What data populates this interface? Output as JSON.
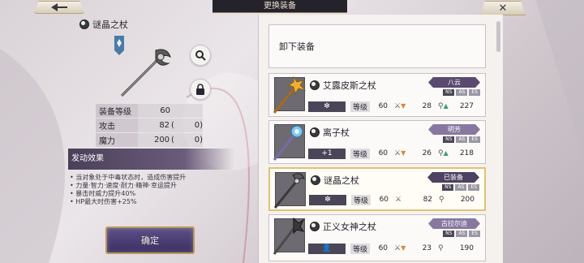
{
  "header": {
    "title": "更换装备"
  },
  "detail": {
    "item_name": "谜晶之杖",
    "stats": [
      {
        "label": "装备等级",
        "value": "60",
        "paren_open": "",
        "bonus": ""
      },
      {
        "label": "攻击",
        "value": "82",
        "paren_open": "(",
        "bonus": "0)"
      },
      {
        "label": "魔力",
        "value": "200",
        "paren_open": "(",
        "bonus": "0)"
      }
    ],
    "effect_title": "发动效果",
    "effects": [
      "• 当对象处于中毒状态时，造成伤害提升",
      "• 力量·智力·速度·耐力·精神·幸运提升",
      "• 暴击时威力提升40%",
      "• HP最大时伤害+25%"
    ],
    "confirm_label": "确定"
  },
  "list": {
    "unequip_label": "卸下装备",
    "level_label": "等级",
    "ns": "NS",
    "as": "AS",
    "es": "ES",
    "items": [
      {
        "name": "艾露皮斯之杖",
        "owner": "八云",
        "slot": "✼",
        "level": "60",
        "atk": "28",
        "atk_trend": "▼",
        "mag": "227",
        "mag_trend": "▲"
      },
      {
        "name": "离子杖",
        "owner": "明芳",
        "slot": "+1",
        "level": "60",
        "atk": "26",
        "atk_trend": "▼",
        "mag": "218",
        "mag_trend": "▲"
      },
      {
        "name": "谜晶之杖",
        "owner": "已装备",
        "slot": "✼",
        "level": "60",
        "atk": "82",
        "atk_trend": "",
        "mag": "200",
        "mag_trend": ""
      },
      {
        "name": "正义女神之杖",
        "owner": "古拉尔迪",
        "slot": "👤",
        "level": "60",
        "atk": "23",
        "atk_trend": "▼",
        "mag": "190",
        "mag_trend": ""
      }
    ]
  },
  "colors": {
    "accent": "#4e4262",
    "selected_border": "#e0c272",
    "trend_down": "#d48a3a",
    "trend_up": "#3aa070"
  }
}
